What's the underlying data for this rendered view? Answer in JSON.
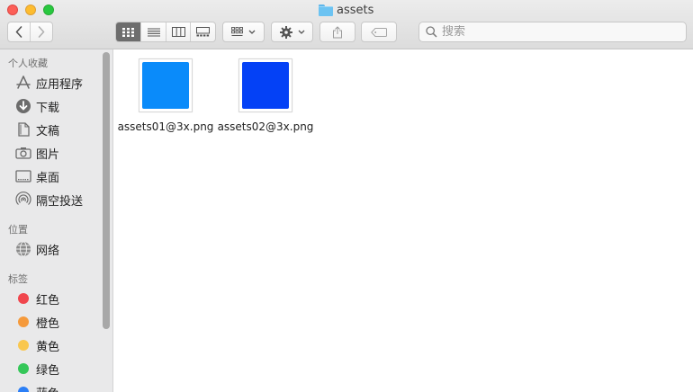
{
  "window": {
    "title": "assets"
  },
  "toolbar": {
    "nav": {
      "back_icon": "chevron-left-icon",
      "forward_icon": "chevron-right-icon"
    },
    "view_modes": [
      "icon-view",
      "list-view",
      "column-view",
      "gallery-view"
    ],
    "active_view": "icon-view",
    "search": {
      "placeholder": "搜索"
    }
  },
  "sidebar": {
    "favorites_title": "个人收藏",
    "favorites": [
      {
        "label": "应用程序",
        "icon": "applications-icon"
      },
      {
        "label": "下载",
        "icon": "downloads-icon"
      },
      {
        "label": "文稿",
        "icon": "documents-icon"
      },
      {
        "label": "图片",
        "icon": "pictures-icon"
      },
      {
        "label": "桌面",
        "icon": "desktop-icon"
      },
      {
        "label": "隔空投送",
        "icon": "airdrop-icon"
      }
    ],
    "locations_title": "位置",
    "locations": [
      {
        "label": "网络",
        "icon": "network-icon"
      }
    ],
    "tags_title": "标签",
    "tags": [
      {
        "label": "红色",
        "color": "#f0464d"
      },
      {
        "label": "橙色",
        "color": "#f59a3c"
      },
      {
        "label": "黄色",
        "color": "#f9c74f"
      },
      {
        "label": "绿色",
        "color": "#35c759"
      },
      {
        "label": "蓝色",
        "color": "#2c7ff6"
      }
    ]
  },
  "files": [
    {
      "name": "assets01@3x.png",
      "swatch": "#0a8bfa"
    },
    {
      "name": "assets02@3x.png",
      "swatch": "#0441f6"
    }
  ]
}
